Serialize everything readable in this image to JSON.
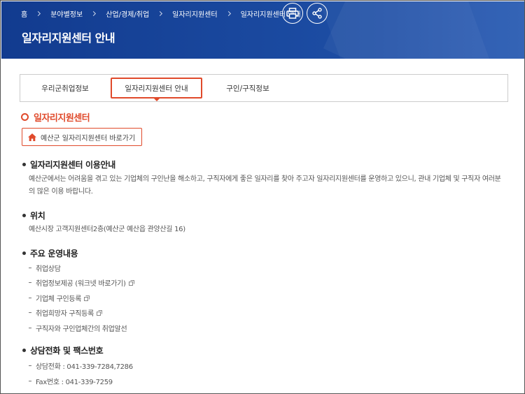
{
  "breadcrumb": [
    "홈",
    "분야별정보",
    "산업/경제/취업",
    "일자리지원센터",
    "일자리지원센터 안내"
  ],
  "header": {
    "title": "일자리지원센터 안내"
  },
  "icons": {
    "print": "print-icon",
    "share": "share-icon",
    "home": "home-icon",
    "external": "new-window-icon"
  },
  "colors": {
    "banner": "#1d4ea5",
    "accent": "#e04a2b"
  },
  "tabs": [
    {
      "label": "우리군취업정보"
    },
    {
      "label": "일자리지원센터 안내",
      "active": true
    },
    {
      "label": "구인/구직정보"
    }
  ],
  "section": {
    "title": "일자리지원센터",
    "shortcut_label": "예산군 일자리지원센터 바로가기"
  },
  "info": {
    "heading": "일자리지원센터 이용안내",
    "text": "예산군에서는 어려움을 겪고 있는 기업체의 구인난을 해소하고, 구직자에게 좋은 일자리를 찾아 주고자 일자리지원센터를 운영하고 있으니, 관내 기업체 및 구직자 여러분의 많은 이용 바랍니다."
  },
  "location": {
    "heading": "위치",
    "text": "예산시장 고객지원센터2층(예산군 예산읍 관양산길 16)"
  },
  "services": {
    "heading": "주요 운영내용",
    "items": [
      "취업상담",
      "취업정보제공 (워크넷 바로가기)",
      "기업체 구인등록",
      "취업희망자 구직등록",
      "구직자와 구인업체간의 취업알선"
    ]
  },
  "contact": {
    "heading": "상담전화 및 팩스번호",
    "items": [
      "상담전화 : 041-339-7284,7286",
      "Fax번호 : 041-339-7259"
    ]
  }
}
